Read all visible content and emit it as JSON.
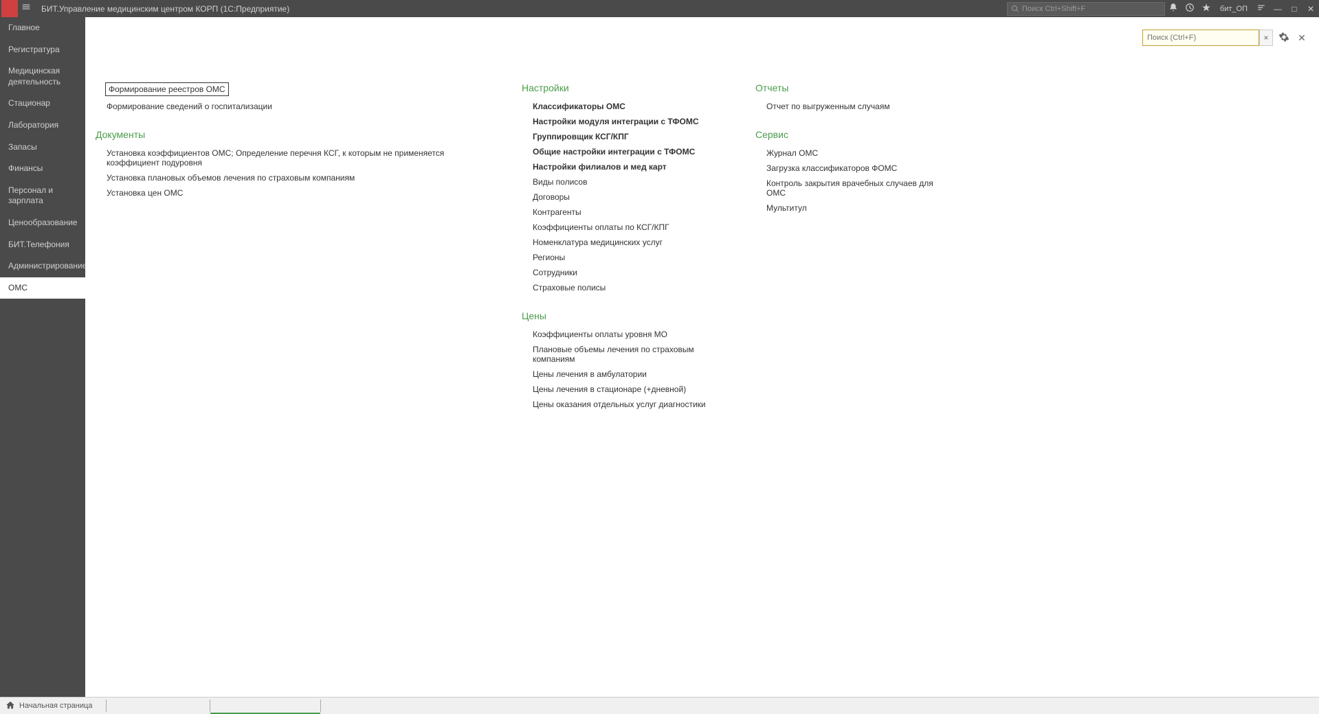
{
  "titlebar": {
    "app_title": "БИТ.Управление медицинским центром КОРП  (1С:Предприятие)",
    "search_placeholder": "Поиск Ctrl+Shift+F",
    "user_label": "бит_ОП"
  },
  "sidebar": {
    "items": [
      {
        "label": "Главное"
      },
      {
        "label": "Регистратура"
      },
      {
        "label": "Медицинская деятельность",
        "multiline": true
      },
      {
        "label": "Стационар"
      },
      {
        "label": "Лаборатория"
      },
      {
        "label": "Запасы"
      },
      {
        "label": "Финансы"
      },
      {
        "label": "Персонал и зарплата"
      },
      {
        "label": "Ценообразование"
      },
      {
        "label": "БИТ.Телефония"
      },
      {
        "label": "Администрирование"
      },
      {
        "label": "ОМС",
        "active": true
      }
    ]
  },
  "content": {
    "search_placeholder": "Поиск (Ctrl+F)",
    "col1": {
      "top_links": [
        {
          "label": "Формирование реестров ОМС",
          "boxed": true
        },
        {
          "label": "Формирование сведений о госпитализации"
        }
      ],
      "documents_title": "Документы",
      "documents_links": [
        {
          "label": "Установка коэффициентов ОМС; Определение перечня КСГ, к которым не применяется коэффициент подуровня"
        },
        {
          "label": "Установка плановых объемов лечения по страховым компаниям"
        },
        {
          "label": "Установка цен ОМС"
        }
      ]
    },
    "col2": {
      "settings_title": "Настройки",
      "settings_links": [
        {
          "label": "Классификаторы ОМС",
          "bold": true
        },
        {
          "label": "Настройки модуля интеграции с ТФОМС",
          "bold": true
        },
        {
          "label": "Группировщик КСГ/КПГ",
          "bold": true
        },
        {
          "label": "Общие настройки интеграции с ТФОМС",
          "bold": true
        },
        {
          "label": "Настройки филиалов и мед карт",
          "bold": true
        },
        {
          "label": "Виды полисов"
        },
        {
          "label": "Договоры"
        },
        {
          "label": "Контрагенты"
        },
        {
          "label": "Коэффициенты оплаты по КСГ/КПГ"
        },
        {
          "label": "Номенклатура медицинских услуг"
        },
        {
          "label": "Регионы"
        },
        {
          "label": "Сотрудники"
        },
        {
          "label": "Страховые полисы"
        }
      ],
      "prices_title": "Цены",
      "prices_links": [
        {
          "label": "Коэффициенты оплаты уровня МО"
        },
        {
          "label": "Плановые объемы лечения по страховым компаниям"
        },
        {
          "label": "Цены лечения в амбулатории"
        },
        {
          "label": "Цены лечения в стационаре (+дневной)"
        },
        {
          "label": "Цены оказания отдельных услуг диагностики"
        }
      ]
    },
    "col3": {
      "reports_title": "Отчеты",
      "reports_links": [
        {
          "label": "Отчет по выгруженным случаям"
        }
      ],
      "service_title": "Сервис",
      "service_links": [
        {
          "label": "Журнал ОМС"
        },
        {
          "label": "Загрузка классификаторов ФОМС"
        },
        {
          "label": "Контроль закрытия врачебных случаев для ОМС"
        },
        {
          "label": "Мультитул"
        }
      ]
    }
  },
  "bottom": {
    "home_label": "Начальная страница"
  }
}
